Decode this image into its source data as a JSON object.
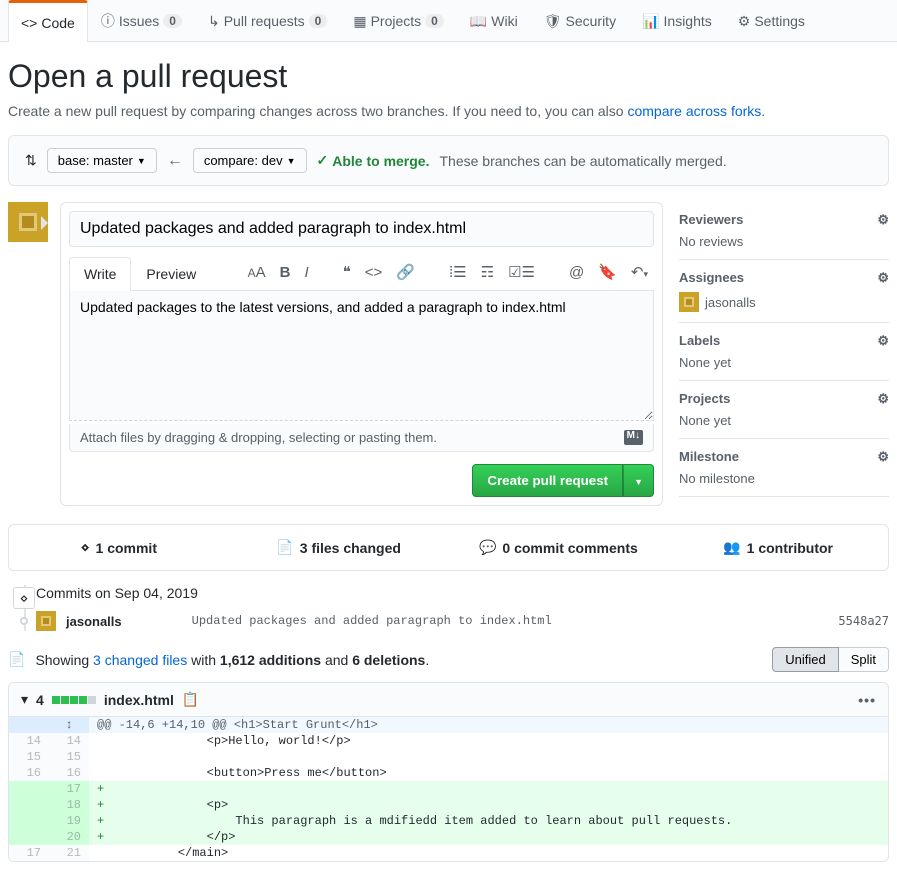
{
  "tabs": {
    "code": "Code",
    "issues": "Issues",
    "issues_count": "0",
    "pulls": "Pull requests",
    "pulls_count": "0",
    "projects": "Projects",
    "projects_count": "0",
    "wiki": "Wiki",
    "security": "Security",
    "insights": "Insights",
    "settings": "Settings"
  },
  "heading": "Open a pull request",
  "subtitle_prefix": "Create a new pull request by comparing changes across two branches. If you need to, you can also ",
  "subtitle_link": "compare across forks",
  "subtitle_suffix": ".",
  "compare": {
    "base": "base: master",
    "head": "compare: dev",
    "merge_status": "Able to merge.",
    "merge_desc": " These branches can be automatically merged."
  },
  "pr": {
    "title": "Updated packages and added paragraph to index.html",
    "write_tab": "Write",
    "preview_tab": "Preview",
    "body": "Updated packages to the latest versions, and added a paragraph to index.html",
    "attach_hint": "Attach files by dragging & dropping, selecting or pasting them.",
    "create_btn": "Create pull request"
  },
  "sidebar": {
    "reviewers": {
      "title": "Reviewers",
      "body": "No reviews"
    },
    "assignees": {
      "title": "Assignees",
      "body": "jasonalls"
    },
    "labels": {
      "title": "Labels",
      "body": "None yet"
    },
    "projects": {
      "title": "Projects",
      "body": "None yet"
    },
    "milestone": {
      "title": "Milestone",
      "body": "No milestone"
    }
  },
  "stats": {
    "commits": "1 commit",
    "files": "3 files changed",
    "comments": "0 commit comments",
    "contributors": "1 contributor"
  },
  "timeline": {
    "date_label": "Commits on Sep 04, 2019",
    "author": "jasonalls",
    "message": "Updated packages and added paragraph to index.html",
    "sha": "5548a27"
  },
  "diff": {
    "showing_prefix": "Showing ",
    "files_link": "3 changed files",
    "with_text": " with ",
    "additions": "1,612 additions",
    "and_text": " and ",
    "deletions": "6 deletions",
    "suffix": ".",
    "unified": "Unified",
    "split": "Split",
    "file_count": "4",
    "filename": "index.html",
    "hunk": "@@ -14,6 +14,10 @@ <h1>Start Grunt</h1>",
    "lines": [
      {
        "old": "14",
        "new": "14",
        "sign": " ",
        "text": "            <p>Hello, world!</p>",
        "cls": ""
      },
      {
        "old": "15",
        "new": "15",
        "sign": " ",
        "text": "",
        "cls": ""
      },
      {
        "old": "16",
        "new": "16",
        "sign": " ",
        "text": "            <button>Press me</button>",
        "cls": ""
      },
      {
        "old": "",
        "new": "17",
        "sign": "+",
        "text": "",
        "cls": "add-row"
      },
      {
        "old": "",
        "new": "18",
        "sign": "+",
        "text": "            <p>",
        "cls": "add-row"
      },
      {
        "old": "",
        "new": "19",
        "sign": "+",
        "text": "                This paragraph is a mdifiedd item added to learn about pull requests.",
        "cls": "add-row"
      },
      {
        "old": "",
        "new": "20",
        "sign": "+",
        "text": "            </p>",
        "cls": "add-row"
      },
      {
        "old": "17",
        "new": "21",
        "sign": " ",
        "text": "        </main>",
        "cls": ""
      }
    ]
  }
}
